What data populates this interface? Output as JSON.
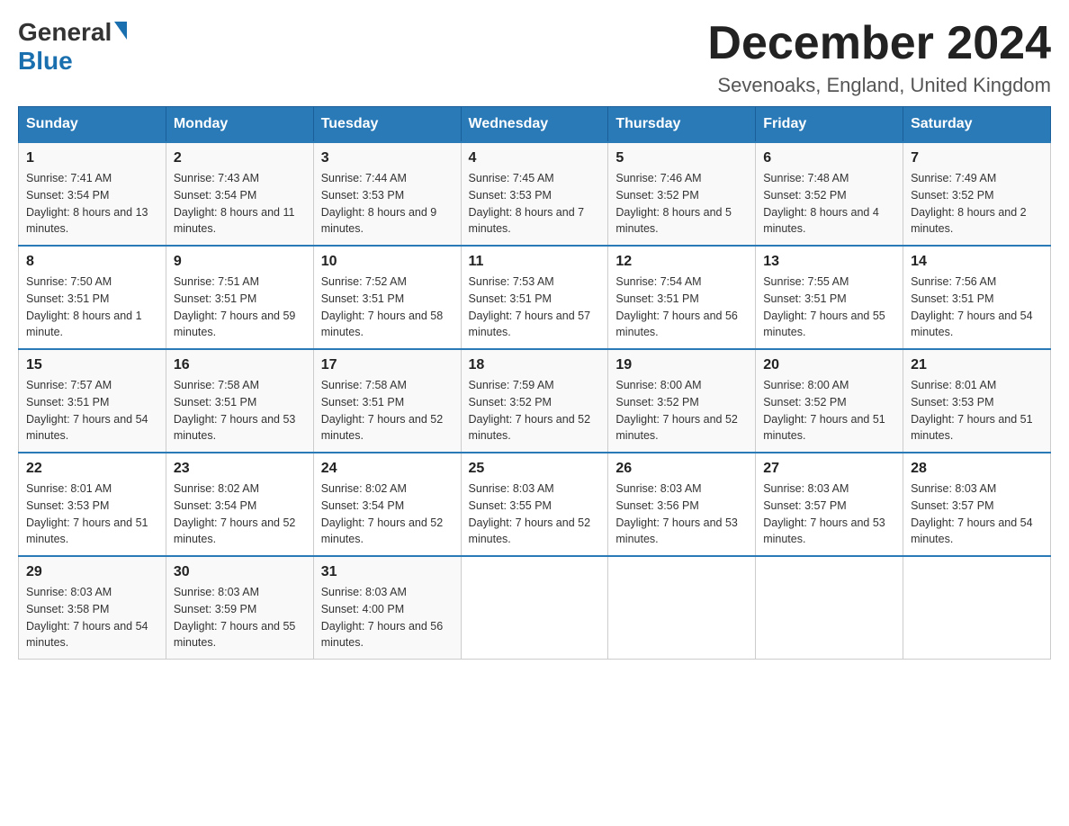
{
  "header": {
    "logo": {
      "general": "General",
      "blue": "Blue"
    },
    "title": "December 2024",
    "subtitle": "Sevenoaks, England, United Kingdom"
  },
  "calendar": {
    "days_of_week": [
      "Sunday",
      "Monday",
      "Tuesday",
      "Wednesday",
      "Thursday",
      "Friday",
      "Saturday"
    ],
    "weeks": [
      [
        {
          "day": "1",
          "sunrise": "7:41 AM",
          "sunset": "3:54 PM",
          "daylight": "8 hours and 13 minutes."
        },
        {
          "day": "2",
          "sunrise": "7:43 AM",
          "sunset": "3:54 PM",
          "daylight": "8 hours and 11 minutes."
        },
        {
          "day": "3",
          "sunrise": "7:44 AM",
          "sunset": "3:53 PM",
          "daylight": "8 hours and 9 minutes."
        },
        {
          "day": "4",
          "sunrise": "7:45 AM",
          "sunset": "3:53 PM",
          "daylight": "8 hours and 7 minutes."
        },
        {
          "day": "5",
          "sunrise": "7:46 AM",
          "sunset": "3:52 PM",
          "daylight": "8 hours and 5 minutes."
        },
        {
          "day": "6",
          "sunrise": "7:48 AM",
          "sunset": "3:52 PM",
          "daylight": "8 hours and 4 minutes."
        },
        {
          "day": "7",
          "sunrise": "7:49 AM",
          "sunset": "3:52 PM",
          "daylight": "8 hours and 2 minutes."
        }
      ],
      [
        {
          "day": "8",
          "sunrise": "7:50 AM",
          "sunset": "3:51 PM",
          "daylight": "8 hours and 1 minute."
        },
        {
          "day": "9",
          "sunrise": "7:51 AM",
          "sunset": "3:51 PM",
          "daylight": "7 hours and 59 minutes."
        },
        {
          "day": "10",
          "sunrise": "7:52 AM",
          "sunset": "3:51 PM",
          "daylight": "7 hours and 58 minutes."
        },
        {
          "day": "11",
          "sunrise": "7:53 AM",
          "sunset": "3:51 PM",
          "daylight": "7 hours and 57 minutes."
        },
        {
          "day": "12",
          "sunrise": "7:54 AM",
          "sunset": "3:51 PM",
          "daylight": "7 hours and 56 minutes."
        },
        {
          "day": "13",
          "sunrise": "7:55 AM",
          "sunset": "3:51 PM",
          "daylight": "7 hours and 55 minutes."
        },
        {
          "day": "14",
          "sunrise": "7:56 AM",
          "sunset": "3:51 PM",
          "daylight": "7 hours and 54 minutes."
        }
      ],
      [
        {
          "day": "15",
          "sunrise": "7:57 AM",
          "sunset": "3:51 PM",
          "daylight": "7 hours and 54 minutes."
        },
        {
          "day": "16",
          "sunrise": "7:58 AM",
          "sunset": "3:51 PM",
          "daylight": "7 hours and 53 minutes."
        },
        {
          "day": "17",
          "sunrise": "7:58 AM",
          "sunset": "3:51 PM",
          "daylight": "7 hours and 52 minutes."
        },
        {
          "day": "18",
          "sunrise": "7:59 AM",
          "sunset": "3:52 PM",
          "daylight": "7 hours and 52 minutes."
        },
        {
          "day": "19",
          "sunrise": "8:00 AM",
          "sunset": "3:52 PM",
          "daylight": "7 hours and 52 minutes."
        },
        {
          "day": "20",
          "sunrise": "8:00 AM",
          "sunset": "3:52 PM",
          "daylight": "7 hours and 51 minutes."
        },
        {
          "day": "21",
          "sunrise": "8:01 AM",
          "sunset": "3:53 PM",
          "daylight": "7 hours and 51 minutes."
        }
      ],
      [
        {
          "day": "22",
          "sunrise": "8:01 AM",
          "sunset": "3:53 PM",
          "daylight": "7 hours and 51 minutes."
        },
        {
          "day": "23",
          "sunrise": "8:02 AM",
          "sunset": "3:54 PM",
          "daylight": "7 hours and 52 minutes."
        },
        {
          "day": "24",
          "sunrise": "8:02 AM",
          "sunset": "3:54 PM",
          "daylight": "7 hours and 52 minutes."
        },
        {
          "day": "25",
          "sunrise": "8:03 AM",
          "sunset": "3:55 PM",
          "daylight": "7 hours and 52 minutes."
        },
        {
          "day": "26",
          "sunrise": "8:03 AM",
          "sunset": "3:56 PM",
          "daylight": "7 hours and 53 minutes."
        },
        {
          "day": "27",
          "sunrise": "8:03 AM",
          "sunset": "3:57 PM",
          "daylight": "7 hours and 53 minutes."
        },
        {
          "day": "28",
          "sunrise": "8:03 AM",
          "sunset": "3:57 PM",
          "daylight": "7 hours and 54 minutes."
        }
      ],
      [
        {
          "day": "29",
          "sunrise": "8:03 AM",
          "sunset": "3:58 PM",
          "daylight": "7 hours and 54 minutes."
        },
        {
          "day": "30",
          "sunrise": "8:03 AM",
          "sunset": "3:59 PM",
          "daylight": "7 hours and 55 minutes."
        },
        {
          "day": "31",
          "sunrise": "8:03 AM",
          "sunset": "4:00 PM",
          "daylight": "7 hours and 56 minutes."
        },
        null,
        null,
        null,
        null
      ]
    ],
    "labels": {
      "sunrise": "Sunrise:",
      "sunset": "Sunset:",
      "daylight": "Daylight:"
    }
  }
}
